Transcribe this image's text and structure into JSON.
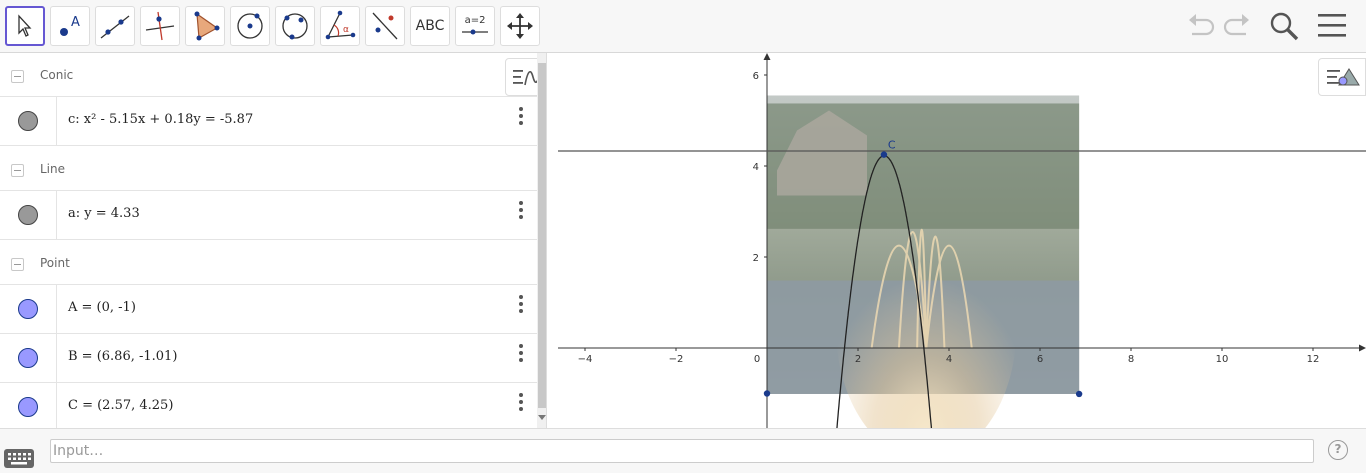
{
  "toolbar": {
    "tools": [
      {
        "name": "move-tool",
        "label": ""
      },
      {
        "name": "point-tool",
        "label": ""
      },
      {
        "name": "line-tool",
        "label": ""
      },
      {
        "name": "perpendicular-line-tool",
        "label": ""
      },
      {
        "name": "polygon-tool",
        "label": ""
      },
      {
        "name": "circle-center-point-tool",
        "label": ""
      },
      {
        "name": "circle-three-points-tool",
        "label": ""
      },
      {
        "name": "angle-tool",
        "label": ""
      },
      {
        "name": "reflect-tool",
        "label": ""
      },
      {
        "name": "text-tool",
        "label": "ABC"
      },
      {
        "name": "slider-tool",
        "label": "a=2"
      },
      {
        "name": "move-graphics-view-tool",
        "label": ""
      }
    ],
    "accent_color": "#6557d2"
  },
  "algebra": {
    "groups": [
      {
        "title": "Conic",
        "items": [
          {
            "expr": "c: x² - 5.15x + 0.18y = -5.87",
            "color": "#888888"
          }
        ]
      },
      {
        "title": "Line",
        "items": [
          {
            "expr": "a: y = 4.33",
            "color": "#888888"
          }
        ]
      },
      {
        "title": "Point",
        "items": [
          {
            "expr": "A = (0, -1)",
            "color": "#9999ff"
          },
          {
            "expr": "B = (6.86, -1.01)",
            "color": "#9999ff"
          },
          {
            "expr": "C = (2.57, 4.25)",
            "color": "#9999ff"
          }
        ]
      }
    ]
  },
  "graphics": {
    "x_ticks": [
      "−4",
      "−2",
      "0",
      "2",
      "4",
      "6",
      "8",
      "10",
      "12"
    ],
    "y_ticks": [
      "6",
      "4",
      "2"
    ],
    "point_label": "C"
  },
  "input": {
    "placeholder": "Input…"
  }
}
